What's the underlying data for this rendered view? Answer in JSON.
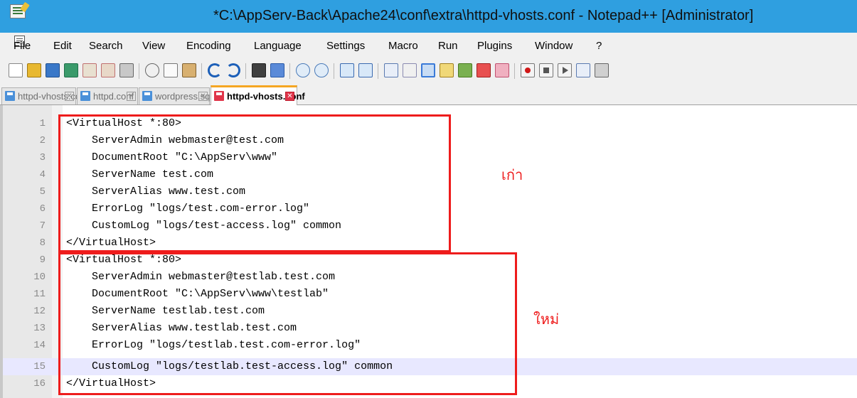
{
  "window": {
    "title": "*C:\\AppServ-Back\\Apache24\\conf\\extra\\httpd-vhosts.conf - Notepad++ [Administrator]",
    "app_icon": "notepad-plus-plus-icon"
  },
  "menu": {
    "items": [
      "File",
      "Edit",
      "Search",
      "View",
      "Encoding",
      "Language",
      "Settings",
      "Macro",
      "Run",
      "Plugins",
      "Window",
      "?"
    ]
  },
  "toolbar": {
    "icons": [
      "new-file-icon",
      "open-file-icon",
      "save-icon",
      "save-all-icon",
      "close-icon",
      "close-all-icon",
      "print-icon",
      "cut-icon",
      "copy-icon",
      "paste-icon",
      "undo-icon",
      "redo-icon",
      "find-icon",
      "replace-icon",
      "zoom-in-icon",
      "zoom-out-icon",
      "sync-vertical-icon",
      "sync-horizontal-icon",
      "word-wrap-icon",
      "show-all-chars-icon",
      "indent-guide-icon",
      "doc-map-icon",
      "function-list-icon",
      "folder-workspace-icon",
      "monitoring-icon",
      "record-macro-icon",
      "stop-record-icon",
      "play-macro-icon",
      "run-macro-multiple-icon",
      "save-macro-icon"
    ]
  },
  "tabs": [
    {
      "label": "httpd-vhosts.conf",
      "active": false
    },
    {
      "label": "httpd.conf",
      "active": false
    },
    {
      "label": "wordpress.sql",
      "active": false
    },
    {
      "label": "httpd-vhosts.conf",
      "active": true
    }
  ],
  "editor": {
    "lines": [
      {
        "n": "1",
        "text": "<VirtualHost *:80>"
      },
      {
        "n": "2",
        "text": "    ServerAdmin webmaster@test.com"
      },
      {
        "n": "3",
        "text": "    DocumentRoot \"C:\\AppServ\\www\""
      },
      {
        "n": "4",
        "text": "    ServerName test.com"
      },
      {
        "n": "5",
        "text": "    ServerAlias www.test.com"
      },
      {
        "n": "6",
        "text": "    ErrorLog \"logs/test.com-error.log\""
      },
      {
        "n": "7",
        "text": "    CustomLog \"logs/test-access.log\" common"
      },
      {
        "n": "8",
        "text": "</VirtualHost>"
      },
      {
        "n": "9",
        "text": "<VirtualHost *:80>"
      },
      {
        "n": "10",
        "text": "    ServerAdmin webmaster@testlab.test.com"
      },
      {
        "n": "11",
        "text": "    DocumentRoot \"C:\\AppServ\\www\\testlab\""
      },
      {
        "n": "12",
        "text": "    ServerName testlab.test.com"
      },
      {
        "n": "13",
        "text": "    ServerAlias www.testlab.test.com"
      },
      {
        "n": "14",
        "text": "    ErrorLog \"logs/testlab.test.com-error.log\""
      },
      {
        "n": "15",
        "text": "    CustomLog \"logs/testlab.test-access.log\" common"
      },
      {
        "n": "16",
        "text": "</VirtualHost>"
      }
    ],
    "current_line": "15"
  },
  "annotations": {
    "old_label": "เก่า",
    "new_label": "ใหม่",
    "color": "#ee1c1c"
  }
}
